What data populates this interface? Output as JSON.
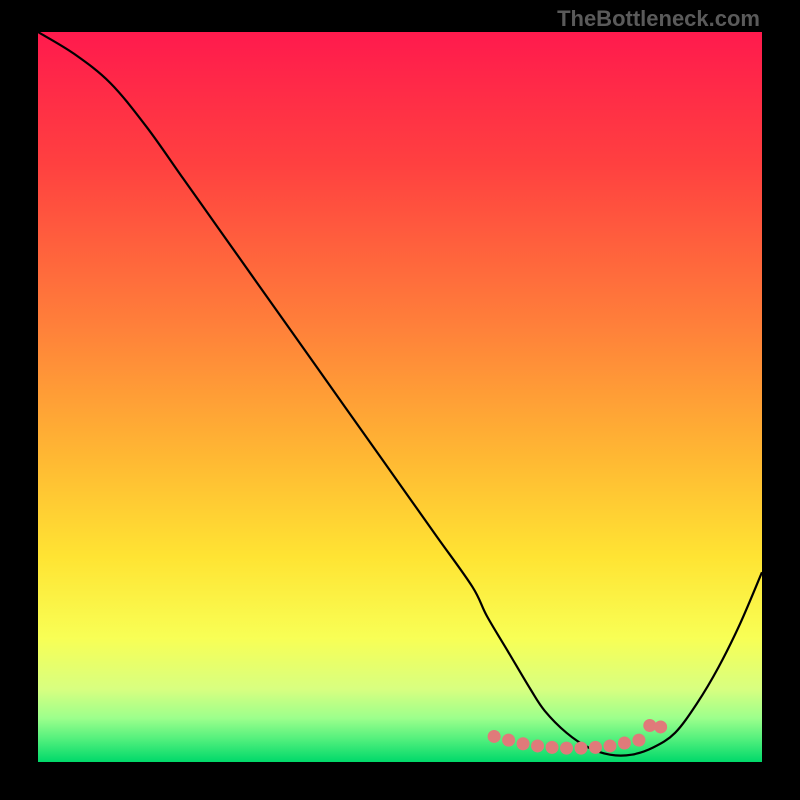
{
  "watermark": "TheBottleneck.com",
  "chart_data": {
    "type": "line",
    "title": "",
    "xlabel": "",
    "ylabel": "",
    "xlim": [
      0,
      100
    ],
    "ylim": [
      0,
      100
    ],
    "x": [
      0,
      5,
      10,
      15,
      20,
      25,
      30,
      35,
      40,
      45,
      50,
      55,
      60,
      62,
      65,
      68,
      70,
      73,
      76,
      79,
      82,
      85,
      88,
      91,
      94,
      97,
      100
    ],
    "values": [
      100,
      97,
      93,
      87,
      80,
      73,
      66,
      59,
      52,
      45,
      38,
      31,
      24,
      20,
      15,
      10,
      7,
      4,
      2,
      1,
      1,
      2,
      4,
      8,
      13,
      19,
      26
    ],
    "marker_points_x": [
      63,
      65,
      67,
      69,
      71,
      73,
      75,
      77,
      79,
      81,
      83,
      84.5,
      86
    ],
    "marker_points_y": [
      3.5,
      3.0,
      2.5,
      2.2,
      2.0,
      1.9,
      1.9,
      2.0,
      2.2,
      2.6,
      3.0,
      5.0,
      4.8
    ],
    "gradient_stops": [
      {
        "offset": 0,
        "color": "#ff1a4d"
      },
      {
        "offset": 18,
        "color": "#ff4040"
      },
      {
        "offset": 40,
        "color": "#ff7f3a"
      },
      {
        "offset": 58,
        "color": "#ffb733"
      },
      {
        "offset": 72,
        "color": "#ffe433"
      },
      {
        "offset": 83,
        "color": "#f8ff55"
      },
      {
        "offset": 90,
        "color": "#d8ff80"
      },
      {
        "offset": 94,
        "color": "#9cff8c"
      },
      {
        "offset": 97,
        "color": "#4fef7c"
      },
      {
        "offset": 100,
        "color": "#00d96a"
      }
    ],
    "curve_color": "#000000",
    "marker_color": "#e07a7a"
  }
}
